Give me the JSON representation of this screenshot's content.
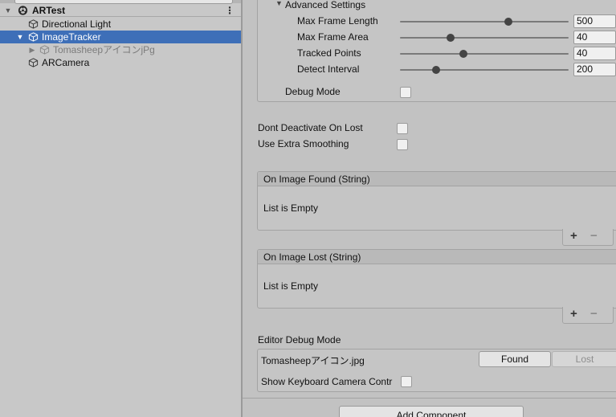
{
  "hierarchy": {
    "scene": {
      "name": "ARTest",
      "menu_icon": "⋮"
    },
    "items": [
      {
        "label": "Directional Light",
        "icon": "gameobject-cube-icon"
      },
      {
        "label": "ImageTracker",
        "icon": "gameobject-cube-icon",
        "selected": true
      },
      {
        "label": "TomasheepアイコンjPg",
        "icon": "gameobject-cube-icon",
        "inactive": true
      },
      {
        "label": "ARCamera",
        "icon": "gameobject-cube-icon"
      }
    ]
  },
  "inspector": {
    "advanced_settings": {
      "title": "Advanced Settings",
      "sliders": [
        {
          "label": "Max Frame Length",
          "value": "500",
          "fraction": 0.645
        },
        {
          "label": "Max Frame Area",
          "value": "40",
          "fraction": 0.3
        },
        {
          "label": "Tracked Points",
          "value": "40",
          "fraction": 0.375
        },
        {
          "label": "Detect Interval",
          "value": "200",
          "fraction": 0.215
        }
      ],
      "debug_mode_label": "Debug Mode"
    },
    "dont_deactivate_label": "Dont Deactivate On Lost",
    "extra_smoothing_label": "Use Extra Smoothing",
    "on_image_found": {
      "title": "On Image Found (String)",
      "empty_text": "List is Empty"
    },
    "on_image_lost": {
      "title": "On Image Lost (String)",
      "empty_text": "List is Empty"
    },
    "list_controls": {
      "add": "+",
      "remove": "−"
    },
    "editor_debug": {
      "title": "Editor Debug Mode",
      "target_name": "Tomasheepアイコン.jpg",
      "found_button": "Found",
      "lost_button": "Lost",
      "keyboard_label": "Show Keyboard Camera Contr"
    },
    "add_component_button": "Add Component"
  },
  "colors": {
    "selection": "#3e6fb8",
    "panel_bg": "#c2c2c2"
  }
}
